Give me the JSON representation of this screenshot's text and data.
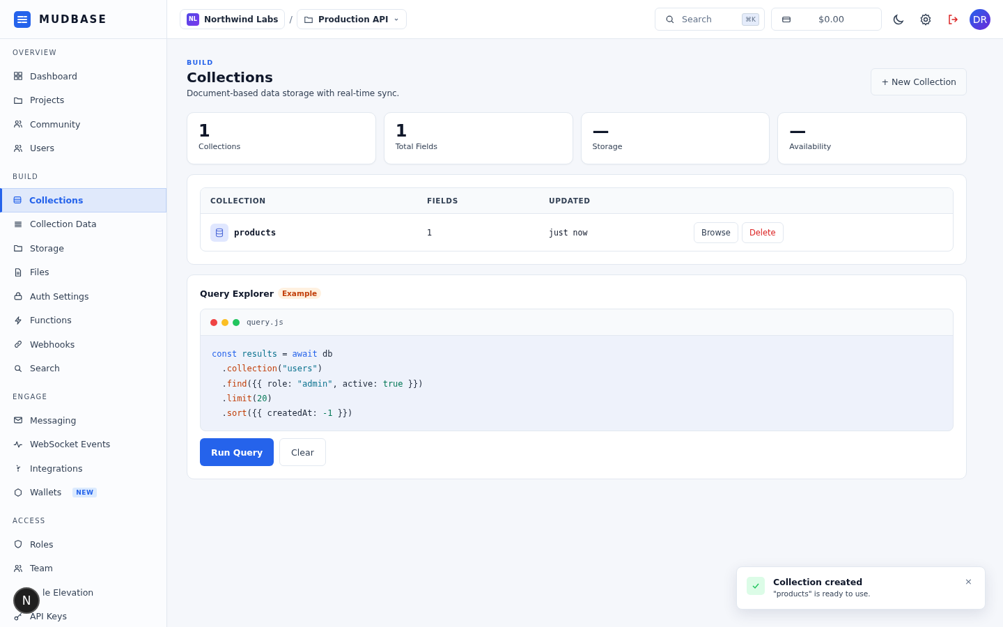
{
  "brand": {
    "name": "MUDBASE"
  },
  "breadcrumb": {
    "org_initials": "NL",
    "org": "Northwind Labs",
    "separator": "/",
    "project": "Production API"
  },
  "header": {
    "search": {
      "placeholder": "Search",
      "shortcut": "⌘K"
    },
    "balance": "$0.00",
    "avatar": "DR"
  },
  "sidebar": {
    "sections": [
      {
        "title": "OVERVIEW",
        "items": [
          {
            "label": "Dashboard",
            "selected": false
          },
          {
            "label": "Projects",
            "selected": false
          },
          {
            "label": "Community",
            "selected": false
          },
          {
            "label": "Users",
            "selected": false
          }
        ]
      },
      {
        "title": "BUILD",
        "items": [
          {
            "label": "Collections",
            "selected": true
          },
          {
            "label": "Collection Data",
            "selected": false
          },
          {
            "label": "Storage",
            "selected": false
          },
          {
            "label": "Files",
            "selected": false
          },
          {
            "label": "Auth Settings",
            "selected": false
          },
          {
            "label": "Functions",
            "selected": false
          },
          {
            "label": "Webhooks",
            "selected": false
          },
          {
            "label": "Search",
            "selected": false
          }
        ]
      },
      {
        "title": "ENGAGE",
        "items": [
          {
            "label": "Messaging",
            "selected": false
          },
          {
            "label": "WebSocket Events",
            "selected": false
          },
          {
            "label": "Integrations",
            "selected": false
          },
          {
            "label": "Wallets",
            "selected": false,
            "badge": "NEW"
          }
        ]
      },
      {
        "title": "ACCESS",
        "items": [
          {
            "label": "Roles",
            "selected": false
          },
          {
            "label": "Team",
            "selected": false
          },
          {
            "label": "le Elevation",
            "selected": false
          },
          {
            "label": "API Keys",
            "selected": false
          }
        ]
      }
    ]
  },
  "floating_badge": "N",
  "page": {
    "eyebrow": "BUILD",
    "title": "Collections",
    "subtitle": "Document-based data storage with real-time sync.",
    "action": "+ New Collection"
  },
  "stats": [
    {
      "value": "1",
      "label": "Collections"
    },
    {
      "value": "1",
      "label": "Total Fields"
    },
    {
      "value": "—",
      "label": "Storage"
    },
    {
      "value": "—",
      "label": "Availability"
    }
  ],
  "table": {
    "columns": [
      "COLLECTION",
      "FIELDS",
      "UPDATED"
    ],
    "rows": [
      {
        "name": "products",
        "fields": "1",
        "updated": "just now",
        "actions": [
          "Browse",
          "Delete"
        ]
      }
    ]
  },
  "query_explorer": {
    "title": "Query Explorer",
    "badge": "Example",
    "filename": "query.js",
    "lines": [
      [
        {
          "kind": "keyword",
          "text": "const"
        },
        {
          "kind": "variable",
          "text": " results"
        },
        {
          "kind": "plain",
          "text": " = "
        },
        {
          "kind": "keyword",
          "text": "await"
        },
        {
          "kind": "plain",
          "text": " db"
        }
      ],
      [
        {
          "kind": "plain",
          "text": "  ."
        },
        {
          "kind": "method",
          "text": "collection"
        },
        {
          "kind": "plain",
          "text": "("
        },
        {
          "kind": "string",
          "text": "\"users\""
        },
        {
          "kind": "plain",
          "text": ")"
        }
      ],
      [
        {
          "kind": "plain",
          "text": "  ."
        },
        {
          "kind": "method",
          "text": "find"
        },
        {
          "kind": "plain",
          "text": "({{ role: "
        },
        {
          "kind": "string",
          "text": "\"admin\""
        },
        {
          "kind": "plain",
          "text": ", active: "
        },
        {
          "kind": "number",
          "text": "true"
        },
        {
          "kind": "plain",
          "text": " }})"
        }
      ],
      [
        {
          "kind": "plain",
          "text": "  ."
        },
        {
          "kind": "method",
          "text": "limit"
        },
        {
          "kind": "plain",
          "text": "("
        },
        {
          "kind": "number",
          "text": "20"
        },
        {
          "kind": "plain",
          "text": ")"
        }
      ],
      [
        {
          "kind": "plain",
          "text": "  ."
        },
        {
          "kind": "method",
          "text": "sort"
        },
        {
          "kind": "plain",
          "text": "({{ createdAt: "
        },
        {
          "kind": "number",
          "text": "-1"
        },
        {
          "kind": "plain",
          "text": " }})"
        }
      ]
    ],
    "buttons": [
      "Run Query",
      "Clear"
    ]
  },
  "toast": {
    "title": "Collection created",
    "message": "\"products\" is ready to use.",
    "close": "×"
  }
}
